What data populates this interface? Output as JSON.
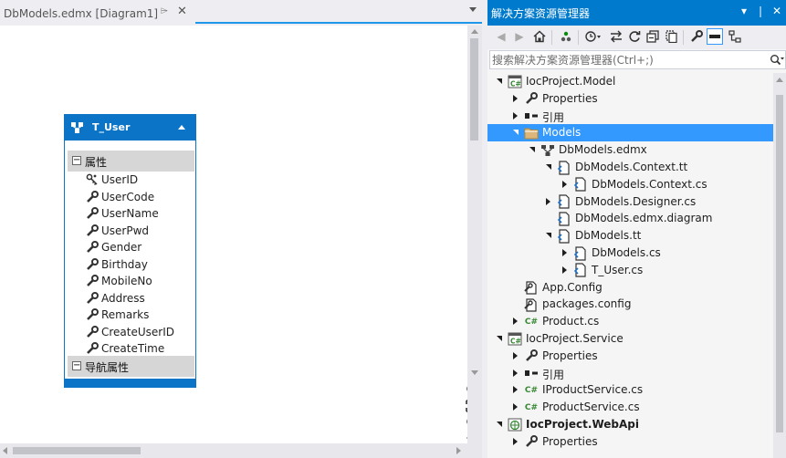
{
  "document": {
    "tab_title": "DbModels.edmx [Diagram1]",
    "pin_glyph": "⌲",
    "close_glyph": "✕"
  },
  "entity": {
    "name": "T_User",
    "properties_label": "属性",
    "navigation_label": "导航属性",
    "collapse_glyph": "−",
    "properties": [
      {
        "name": "UserID",
        "key": true
      },
      {
        "name": "UserCode",
        "key": false
      },
      {
        "name": "UserName",
        "key": false
      },
      {
        "name": "UserPwd",
        "key": false
      },
      {
        "name": "Gender",
        "key": false
      },
      {
        "name": "Birthday",
        "key": false
      },
      {
        "name": "MobileNo",
        "key": false
      },
      {
        "name": "Address",
        "key": false
      },
      {
        "name": "Remarks",
        "key": false
      },
      {
        "name": "CreateUserID",
        "key": false
      },
      {
        "name": "CreateTime",
        "key": false
      }
    ]
  },
  "explorer": {
    "title": "解决方案资源管理器",
    "search_placeholder": "搜索解决方案资源管理器(Ctrl+;)",
    "tree": [
      {
        "label": "IocProject.Model",
        "depth": 0,
        "expander": "open",
        "icon": "csproj",
        "bold": false,
        "selected": false
      },
      {
        "label": "Properties",
        "depth": 1,
        "expander": "closed",
        "icon": "wrench",
        "bold": false,
        "selected": false
      },
      {
        "label": "引用",
        "depth": 1,
        "expander": "closed",
        "icon": "references",
        "bold": false,
        "selected": false
      },
      {
        "label": "Models",
        "depth": 1,
        "expander": "open",
        "icon": "folder",
        "bold": false,
        "selected": true
      },
      {
        "label": "DbModels.edmx",
        "depth": 2,
        "expander": "open",
        "icon": "edmx",
        "bold": false,
        "selected": false
      },
      {
        "label": "DbModels.Context.tt",
        "depth": 3,
        "expander": "open",
        "icon": "tt",
        "bold": false,
        "selected": false
      },
      {
        "label": "DbModels.Context.cs",
        "depth": 4,
        "expander": "closed",
        "icon": "tt",
        "bold": false,
        "selected": false
      },
      {
        "label": "DbModels.Designer.cs",
        "depth": 3,
        "expander": "closed",
        "icon": "tt",
        "bold": false,
        "selected": false
      },
      {
        "label": "DbModels.edmx.diagram",
        "depth": 3,
        "expander": "none",
        "icon": "tt",
        "bold": false,
        "selected": false
      },
      {
        "label": "DbModels.tt",
        "depth": 3,
        "expander": "open",
        "icon": "tt",
        "bold": false,
        "selected": false
      },
      {
        "label": "DbModels.cs",
        "depth": 4,
        "expander": "closed",
        "icon": "tt",
        "bold": false,
        "selected": false
      },
      {
        "label": "T_User.cs",
        "depth": 4,
        "expander": "closed",
        "icon": "tt",
        "bold": false,
        "selected": false
      },
      {
        "label": "App.Config",
        "depth": 1,
        "expander": "none",
        "icon": "config",
        "bold": false,
        "selected": false
      },
      {
        "label": "packages.config",
        "depth": 1,
        "expander": "none",
        "icon": "config",
        "bold": false,
        "selected": false
      },
      {
        "label": "Product.cs",
        "depth": 1,
        "expander": "closed",
        "icon": "cs",
        "bold": false,
        "selected": false
      },
      {
        "label": "IocProject.Service",
        "depth": 0,
        "expander": "open",
        "icon": "csproj",
        "bold": false,
        "selected": false
      },
      {
        "label": "Properties",
        "depth": 1,
        "expander": "closed",
        "icon": "wrench",
        "bold": false,
        "selected": false
      },
      {
        "label": "引用",
        "depth": 1,
        "expander": "closed",
        "icon": "references",
        "bold": false,
        "selected": false
      },
      {
        "label": "IProductService.cs",
        "depth": 1,
        "expander": "closed",
        "icon": "cs",
        "bold": false,
        "selected": false
      },
      {
        "label": "ProductService.cs",
        "depth": 1,
        "expander": "closed",
        "icon": "cs",
        "bold": false,
        "selected": false
      },
      {
        "label": "IocProject.WebApi",
        "depth": 0,
        "expander": "open",
        "icon": "webproj",
        "bold": true,
        "selected": false
      },
      {
        "label": "Properties",
        "depth": 1,
        "expander": "closed",
        "icon": "wrench",
        "bold": false,
        "selected": false
      }
    ]
  },
  "colors": {
    "accent": "#007acc",
    "entity_blue": "#0b74c7",
    "selection": "#3399ff"
  }
}
